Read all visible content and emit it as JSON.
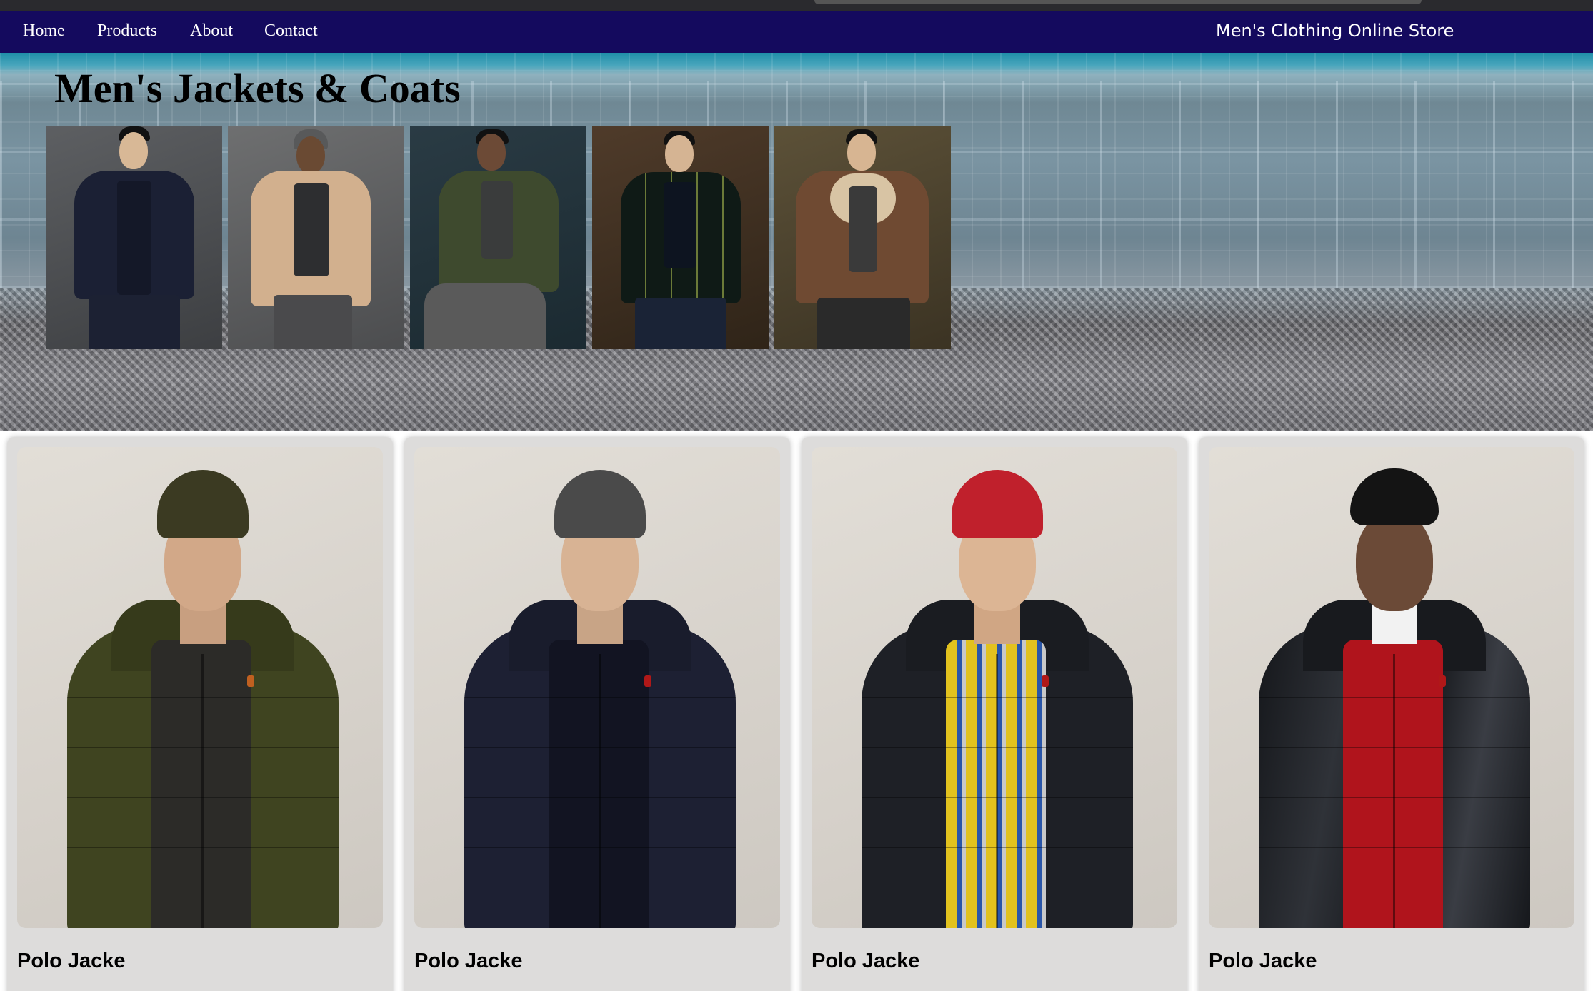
{
  "nav": {
    "links": [
      "Home",
      "Products",
      "About",
      "Contact"
    ],
    "brand": "Men's Clothing Online Store"
  },
  "hero": {
    "title": "Men's Jackets & Coats"
  },
  "products": [
    {
      "title": "Polo Jacke"
    },
    {
      "title": "Polo Jacke"
    },
    {
      "title": "Polo Jacke"
    },
    {
      "title": "Polo Jacke"
    }
  ],
  "colors": {
    "nav_bg": "#140a5e",
    "card_bg": "#dddcdb",
    "accent_red": "#b01818"
  }
}
